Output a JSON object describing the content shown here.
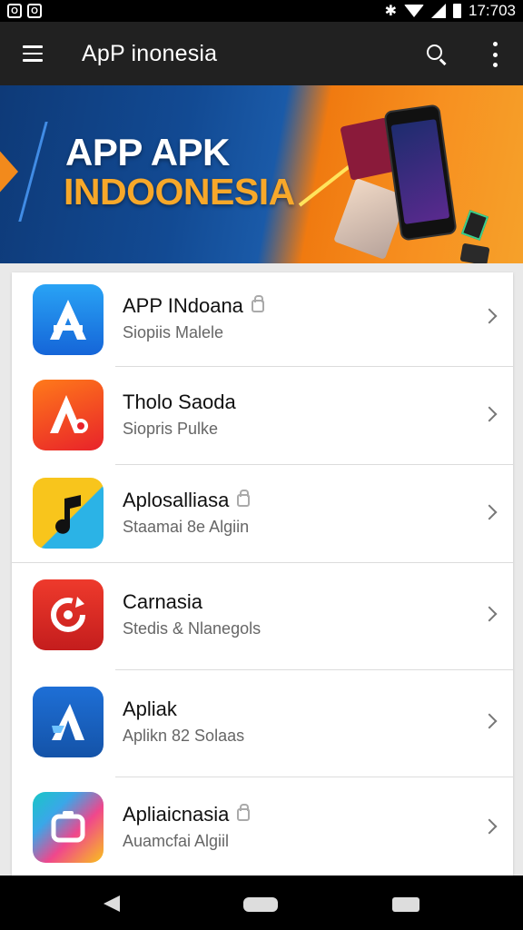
{
  "status_bar": {
    "time": "17:703",
    "notifications": [
      "O",
      "O"
    ]
  },
  "app_bar": {
    "title": "ApP inonesia"
  },
  "banner": {
    "line1": "APP APK",
    "line2": "INDOONESIA",
    "colors": {
      "left": "#124a93",
      "right": "#f07a10",
      "accent": "#f7a82a"
    }
  },
  "apps": [
    {
      "title": "APP INdoana",
      "subtitle": "Siopiis Malele",
      "locked": true,
      "icon": "app-store-a-icon"
    },
    {
      "title": "Tholo Saoda",
      "subtitle": "Siopris Pulke",
      "locked": false,
      "icon": "red-a-icon"
    },
    {
      "title": "Aplosalliasa",
      "subtitle": "Staamai 8e Algiin",
      "locked": true,
      "icon": "music-note-icon"
    },
    {
      "title": "Carnasia",
      "subtitle": "Stedis & Nlanegols",
      "locked": false,
      "icon": "refresh-circle-icon"
    },
    {
      "title": "Apliak",
      "subtitle": "Aplikn 82 Solaas",
      "locked": false,
      "icon": "blue-a-icon"
    },
    {
      "title": "Apliaicnasia",
      "subtitle": "Auamcfai Algiil",
      "locked": true,
      "icon": "gradient-square-icon"
    }
  ]
}
